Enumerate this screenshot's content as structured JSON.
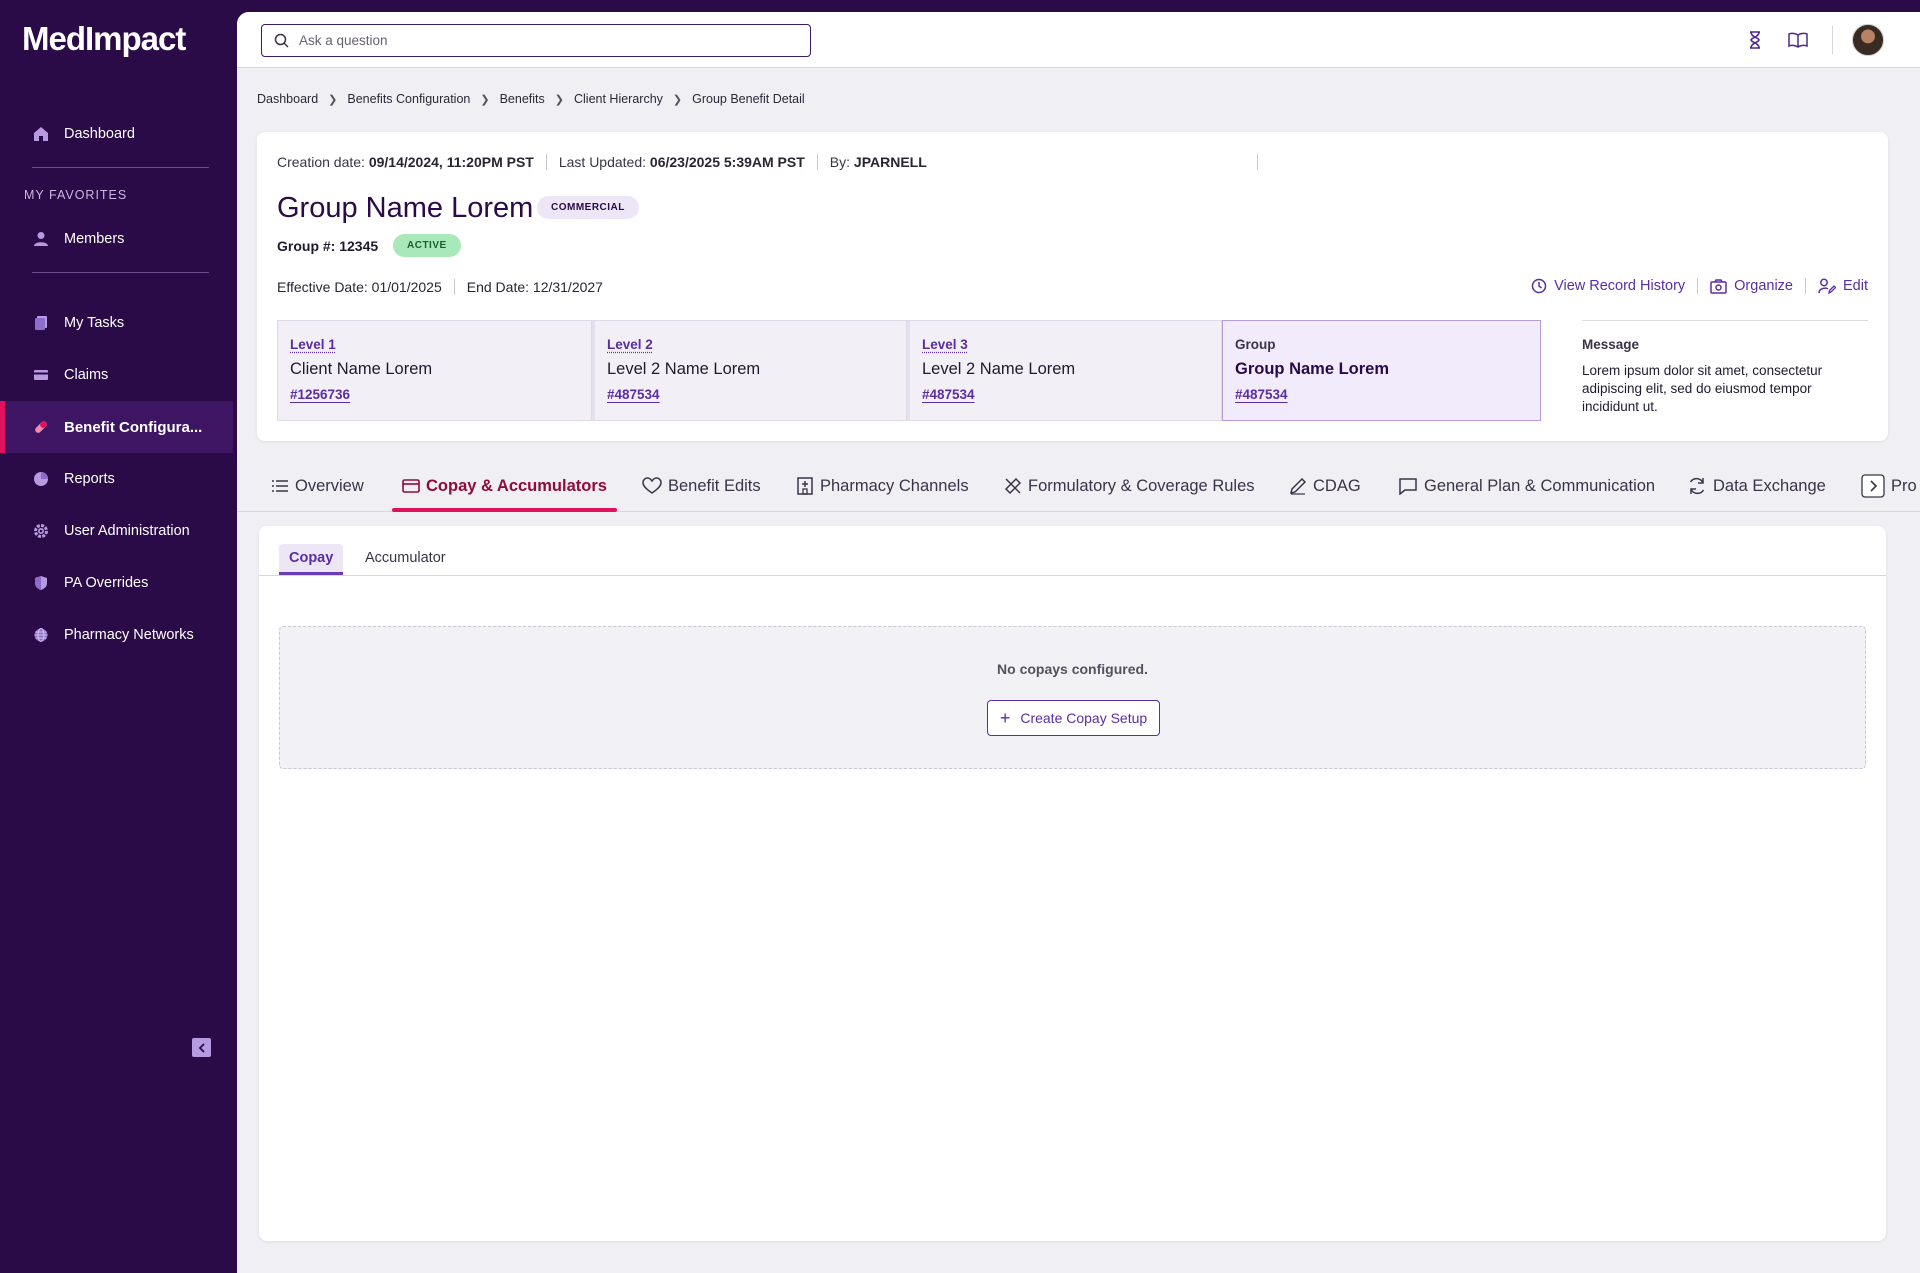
{
  "app": {
    "logo": "MedImpact"
  },
  "sidebar": {
    "favorites_label": "MY FAVORITES",
    "items": [
      {
        "label": "Dashboard",
        "icon": "home-icon"
      },
      {
        "label": "Members",
        "icon": "person-icon"
      },
      {
        "label": "My Tasks",
        "icon": "tasks-icon"
      },
      {
        "label": "Claims",
        "icon": "card-icon"
      },
      {
        "label": "Benefit Configura...",
        "icon": "pill-icon",
        "active": true
      },
      {
        "label": "Reports",
        "icon": "pie-icon"
      },
      {
        "label": "User Administration",
        "icon": "gear-icon"
      },
      {
        "label": "PA Overrides",
        "icon": "shield-icon"
      },
      {
        "label": "Pharmacy Networks",
        "icon": "globe-icon"
      }
    ]
  },
  "search": {
    "placeholder": "Ask a question"
  },
  "breadcrumb": [
    "Dashboard",
    "Benefits Configuration",
    "Benefits",
    "Client Hierarchy",
    "Group Benefit Detail"
  ],
  "header": {
    "creation_label": "Creation date:",
    "creation_value": "09/14/2024, 11:20PM PST",
    "updated_label": "Last Updated:",
    "updated_value": "06/23/2025 5:39AM PST",
    "by_label": "By:",
    "by_value": "JPARNELL",
    "group_name": "Group Name Lorem",
    "type_badge": "COMMERCIAL",
    "group_number": "Group #: 12345",
    "status_badge": "ACTIVE",
    "effective_date": "Effective Date: 01/01/2025",
    "end_date": "End Date: 12/31/2027",
    "actions": {
      "history": "View Record History",
      "organize": "Organize",
      "edit": "Edit"
    },
    "levels": [
      {
        "label": "Level 1",
        "name": "Client Name Lorem",
        "number": "#1256736"
      },
      {
        "label": "Level 2",
        "name": "Level 2 Name Lorem",
        "number": "#487534"
      },
      {
        "label": "Level 3",
        "name": "Level 2 Name Lorem",
        "number": "#487534"
      },
      {
        "label": "Group",
        "name": "Group Name Lorem",
        "number": "#487534"
      }
    ],
    "message": {
      "label": "Message",
      "text": "Lorem ipsum dolor sit amet, consectetur adipiscing elit, sed do eiusmod tempor incididunt ut."
    }
  },
  "tabs": [
    "Overview",
    "Copay & Accumulators",
    "Benefit Edits",
    "Pharmacy Channels",
    "Formulatory & Coverage Rules",
    "CDAG",
    "General Plan & Communication",
    "Data Exchange",
    "Pro"
  ],
  "active_tab": "Copay & Accumulators",
  "subtabs": [
    "Copay",
    "Accumulator"
  ],
  "content": {
    "empty_message": "No copays configured.",
    "create_button": "Create Copay Setup"
  },
  "colors": {
    "sidebar": "#2a0a47",
    "accent": "#e0115f",
    "primary": "#5a2ea0",
    "active_badge": "#a9e9b9"
  }
}
